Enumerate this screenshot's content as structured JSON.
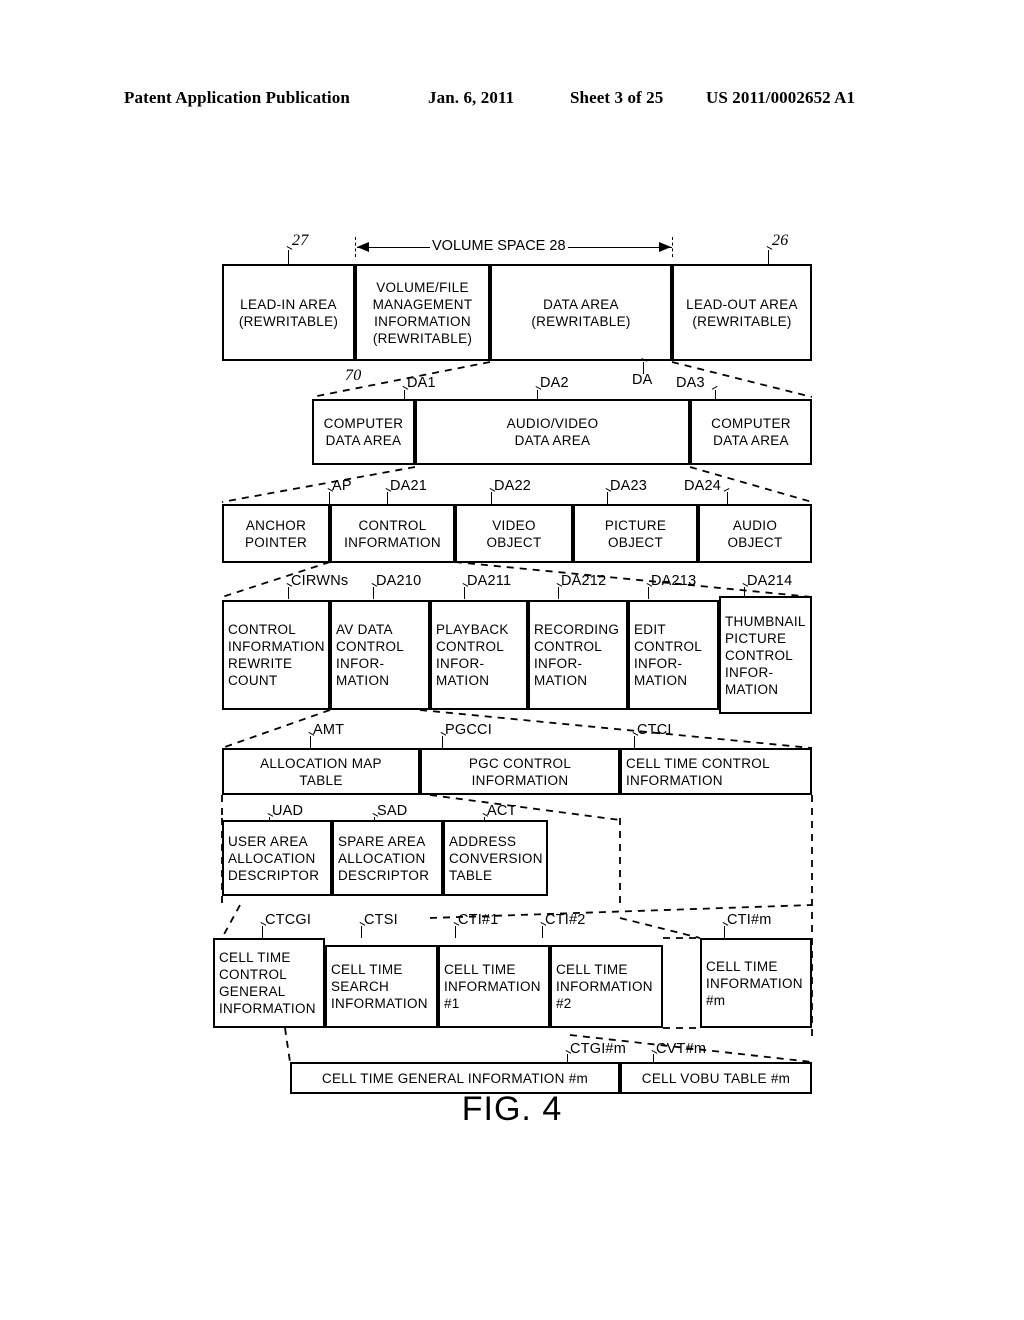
{
  "header": {
    "publication": "Patent Application Publication",
    "date": "Jan. 6, 2011",
    "sheet": "Sheet 3 of 25",
    "number": "US 2011/0002652 A1"
  },
  "figure": {
    "caption": "FIG. 4"
  },
  "volume_space": {
    "label": "VOLUME SPACE 28"
  },
  "rows": {
    "row1": {
      "refs": {
        "left": "27",
        "right": "26"
      },
      "cells": [
        {
          "code": "",
          "lines": [
            "LEAD-IN AREA",
            "(REWRITABLE)"
          ]
        },
        {
          "code": "",
          "lines": [
            "VOLUME/FILE",
            "MANAGEMENT",
            "INFORMATION",
            "(REWRITABLE)"
          ]
        },
        {
          "code": "",
          "lines": [
            "DATA AREA",
            "(REWRITABLE)"
          ]
        },
        {
          "code": "",
          "lines": [
            "LEAD-OUT AREA",
            "(REWRITABLE)"
          ]
        }
      ]
    },
    "row2": {
      "refs": [
        "70",
        "DA1",
        "DA2",
        "DA",
        "DA3"
      ],
      "cells": [
        {
          "code": "DA1",
          "lines": [
            "COMPUTER",
            "DATA AREA"
          ]
        },
        {
          "code": "DA2",
          "lines": [
            "AUDIO/VIDEO",
            "DATA AREA"
          ]
        },
        {
          "code": "DA3",
          "lines": [
            "COMPUTER",
            "DATA AREA"
          ]
        }
      ]
    },
    "row3": {
      "cells": [
        {
          "code": "AP",
          "lines": [
            "ANCHOR",
            "POINTER"
          ]
        },
        {
          "code": "DA21",
          "lines": [
            "CONTROL",
            "INFORMATION"
          ]
        },
        {
          "code": "DA22",
          "lines": [
            "VIDEO",
            "OBJECT"
          ]
        },
        {
          "code": "DA23",
          "lines": [
            "PICTURE",
            "OBJECT"
          ]
        },
        {
          "code": "DA24",
          "lines": [
            "AUDIO",
            "OBJECT"
          ]
        }
      ]
    },
    "row4": {
      "cells": [
        {
          "code": "CIRWNs",
          "lines": [
            "CONTROL",
            "INFORMATION",
            "REWRITE",
            "COUNT"
          ]
        },
        {
          "code": "DA210",
          "lines": [
            "AV DATA",
            "CONTROL",
            "INFOR-",
            "MATION"
          ]
        },
        {
          "code": "DA211",
          "lines": [
            "PLAYBACK",
            "CONTROL",
            "INFOR-",
            "MATION"
          ]
        },
        {
          "code": "DA212",
          "lines": [
            "RECORDING",
            "CONTROL",
            "INFOR-",
            "MATION"
          ]
        },
        {
          "code": "DA213",
          "lines": [
            "EDIT",
            "CONTROL",
            "INFOR-",
            "MATION"
          ]
        },
        {
          "code": "DA214",
          "lines": [
            "THUMBNAIL",
            "PICTURE",
            "CONTROL",
            "INFOR-",
            "MATION"
          ]
        }
      ]
    },
    "row5": {
      "cells": [
        {
          "code": "AMT",
          "lines": [
            "ALLOCATION MAP",
            "TABLE"
          ]
        },
        {
          "code": "PGCCI",
          "lines": [
            "PGC CONTROL",
            "INFORMATION"
          ]
        },
        {
          "code": "CTCI",
          "lines": [
            "CELL TIME CONTROL",
            "INFORMATION"
          ]
        }
      ]
    },
    "row6": {
      "cells": [
        {
          "code": "UAD",
          "lines": [
            "USER AREA",
            "ALLOCATION",
            "DESCRIPTOR"
          ]
        },
        {
          "code": "SAD",
          "lines": [
            "SPARE AREA",
            "ALLOCATION",
            "DESCRIPTOR"
          ]
        },
        {
          "code": "ACT",
          "lines": [
            "ADDRESS",
            "CONVERSION",
            "TABLE"
          ]
        }
      ]
    },
    "row7": {
      "cells": [
        {
          "code": "CTCGI",
          "lines": [
            "CELL TIME",
            "CONTROL",
            "GENERAL",
            "INFORMATION"
          ]
        },
        {
          "code": "CTSI",
          "lines": [
            "CELL TIME",
            "SEARCH",
            "INFORMATION"
          ]
        },
        {
          "code": "CTI#1",
          "lines": [
            "CELL TIME",
            "INFORMATION",
            "#1"
          ]
        },
        {
          "code": "CTI#2",
          "lines": [
            "CELL TIME",
            "INFORMATION",
            "#2"
          ]
        }
      ],
      "last_cell": {
        "code": "CTI#m",
        "lines": [
          "CELL TIME",
          "INFORMATION",
          "#m"
        ]
      }
    },
    "row8": {
      "cells": [
        {
          "code": "CTGI#m",
          "lines": [
            "CELL TIME GENERAL INFORMATION #m"
          ]
        },
        {
          "code": "CVT#m",
          "lines": [
            "CELL VOBU TABLE #m"
          ]
        }
      ]
    }
  }
}
